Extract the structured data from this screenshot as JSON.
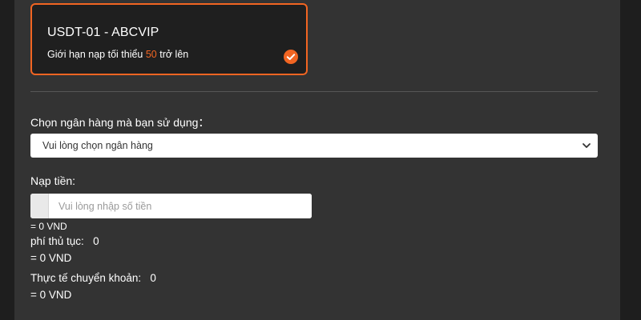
{
  "channel": {
    "title": "USDT-01 - ABCVIP",
    "limit_prefix": "Giới hạn nạp tối thiểu ",
    "limit_amount": "50",
    "limit_suffix": " trở lên",
    "selected": true
  },
  "bank": {
    "label": "Chọn ngân hàng mà bạn sử dụng：",
    "placeholder": "Vui lòng chọn ngân hàng"
  },
  "deposit": {
    "label": "Nạp tiền:",
    "input_placeholder": "Vui lòng nhập số tiền",
    "converted": "= 0 VND"
  },
  "fee": {
    "label": "phí thủ tục:",
    "value": "0",
    "converted": "= 0 VND"
  },
  "actual": {
    "label": "Thực tế chuyển khoản:",
    "value": "0",
    "converted": "= 0 VND"
  },
  "colors": {
    "accent": "#f26522",
    "panel": "#333333",
    "card": "#1f1f1f"
  }
}
